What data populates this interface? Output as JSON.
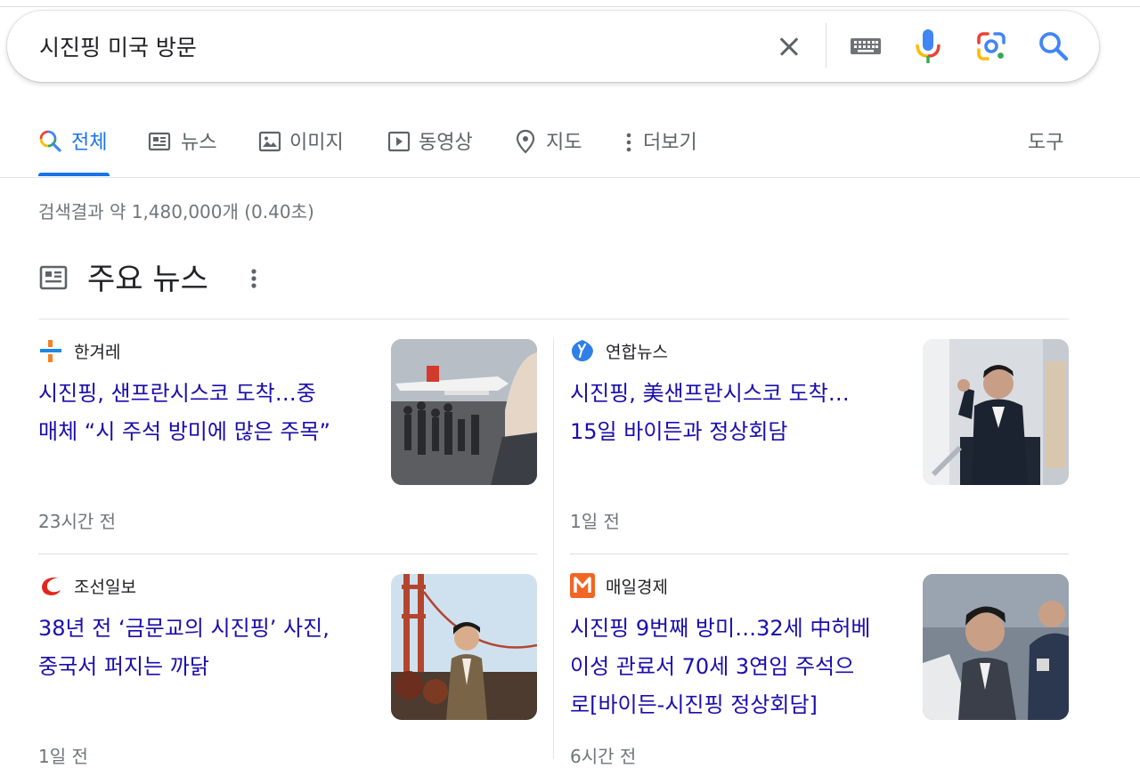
{
  "search": {
    "query": "시진핑 미국 방문"
  },
  "tabs": [
    {
      "label": "전체",
      "icon": "search-multicolor-icon",
      "active": true
    },
    {
      "label": "뉴스",
      "icon": "newspaper-icon"
    },
    {
      "label": "이미지",
      "icon": "image-icon"
    },
    {
      "label": "동영상",
      "icon": "play-icon"
    },
    {
      "label": "지도",
      "icon": "map-pin-icon"
    },
    {
      "label": "더보기",
      "icon": "more-vert-icon"
    }
  ],
  "tools_label": "도구",
  "stats": "검색결과 약 1,480,000개 (0.40초)",
  "top_news": {
    "title": "주요 뉴스",
    "articles": [
      {
        "source": "한겨레",
        "headline_lines": [
          "시진핑, 샌프란시스코 도착…중",
          "매체 “시 주석 방미에 많은 주목”"
        ],
        "time": "23시간 전"
      },
      {
        "source": "연합뉴스",
        "headline_lines": [
          "시진핑, 美샌프란시스코 도착…",
          "15일 바이든과 정상회담"
        ],
        "time": "1일 전"
      },
      {
        "source": "조선일보",
        "headline_lines": [
          "38년 전 ‘금문교의 시진핑’ 사진,",
          "중국서 퍼지는 까닭"
        ],
        "time": "1일 전"
      },
      {
        "source": "매일경제",
        "headline_lines": [
          "시진핑 9번째 방미…32세 中허베",
          "이성 관료서 70세 3연임 주석으",
          "로[바이든-시진핑 정상회담]"
        ],
        "time": "6시간 전"
      }
    ]
  },
  "colors": {
    "link": "#1a0dab",
    "accent": "#1a73e8",
    "muted": "#70757a",
    "hani_orange": "#f4821f",
    "hani_blue": "#1e88e5",
    "yonhap_blue": "#2f7fe8",
    "chosun_red": "#e3261c",
    "mk_orange": "#f26522"
  }
}
